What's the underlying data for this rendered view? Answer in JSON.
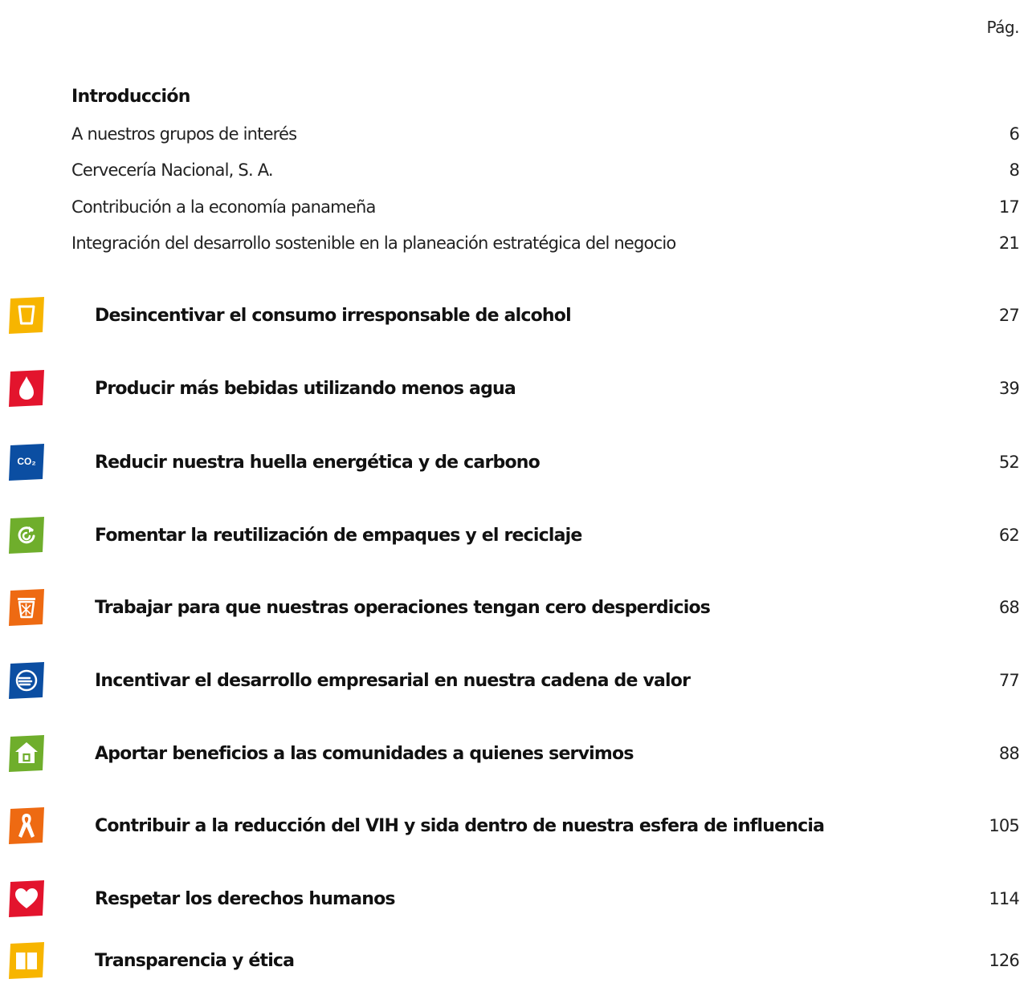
{
  "header": {
    "page_label": "Pág."
  },
  "intro": {
    "title": "Introducción",
    "items": [
      {
        "label": "A nuestros grupos de interés",
        "page": "6"
      },
      {
        "label": "Cervecería Nacional, S. A.",
        "page": "8"
      },
      {
        "label": "Contribución a la economía panameña",
        "page": "17"
      },
      {
        "label": "Integración del desarrollo sostenible en la planeación estratégica del negocio",
        "page": "21"
      }
    ]
  },
  "sections": [
    {
      "label": "Desincentivar el consumo irresponsable de alcohol",
      "page": "27",
      "icon": "glass-icon",
      "color": "#F7B500"
    },
    {
      "label": "Producir más bebidas utilizando menos agua",
      "page": "39",
      "icon": "water-drop-icon",
      "color": "#E3142D"
    },
    {
      "label": "Reducir nuestra huella energética y de carbono",
      "page": "52",
      "icon": "co2-icon",
      "color": "#0B4EA2",
      "icon_text": "CO₂"
    },
    {
      "label": "Fomentar la reutilización de empaques y el reciclaje",
      "page": "62",
      "icon": "recycle-icon",
      "color": "#6FAE2C"
    },
    {
      "label": "Trabajar para que nuestras operaciones tengan cero desperdicios",
      "page": "68",
      "icon": "waste-bin-icon",
      "color": "#EE6A12"
    },
    {
      "label": "Incentivar el desarrollo empresarial en nuestra cadena de valor",
      "page": "77",
      "icon": "handshake-icon",
      "color": "#0B4EA2"
    },
    {
      "label": "Aportar beneficios a las comunidades a quienes servimos",
      "page": "88",
      "icon": "house-icon",
      "color": "#6FAE2C"
    },
    {
      "label": "Contribuir a la reducción del VIH y sida dentro de nuestra esfera de influencia",
      "page": "105",
      "icon": "ribbon-icon",
      "color": "#EE6A12"
    },
    {
      "label": "Respetar los derechos humanos",
      "page": "114",
      "icon": "heart-icon",
      "color": "#E3142D"
    },
    {
      "label": "Transparencia y ética",
      "page": "126",
      "icon": "book-icon",
      "color": "#F7B500"
    }
  ]
}
